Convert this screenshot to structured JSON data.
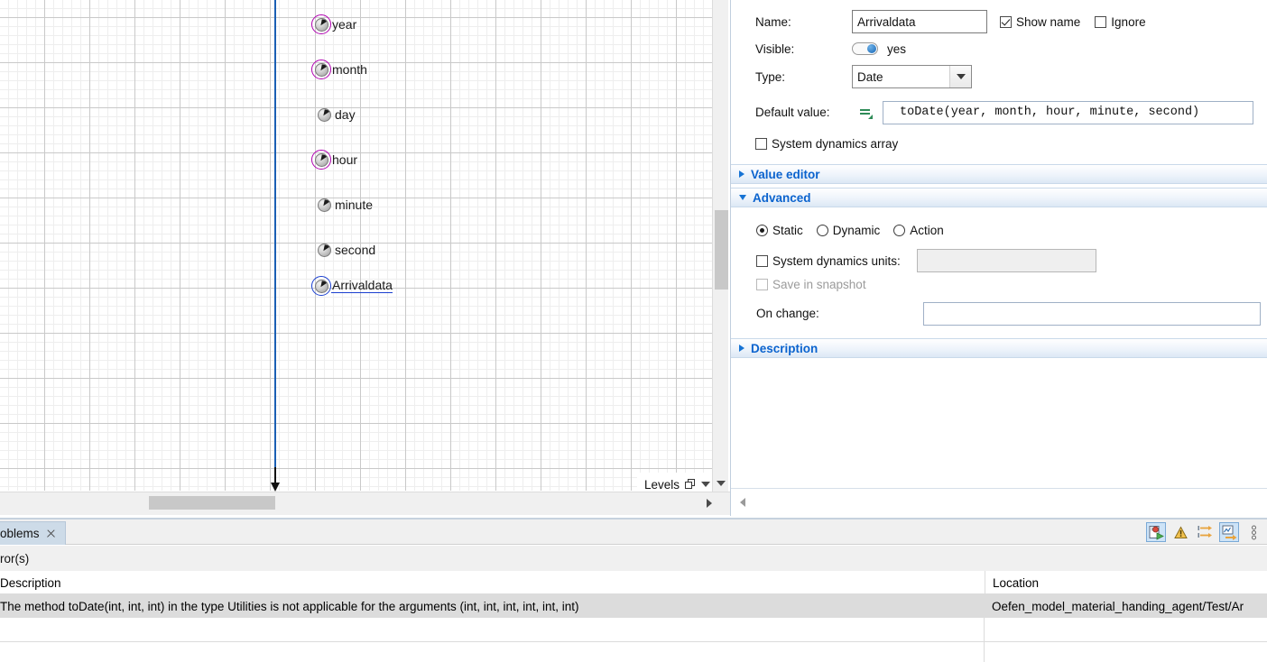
{
  "canvas": {
    "parameters": [
      {
        "label": "year",
        "selected": true,
        "ring": "magenta",
        "underline": false
      },
      {
        "label": "month",
        "selected": true,
        "ring": "magenta",
        "underline": false
      },
      {
        "label": "day",
        "selected": false,
        "ring": "none",
        "underline": false
      },
      {
        "label": "hour",
        "selected": true,
        "ring": "magenta",
        "underline": false
      },
      {
        "label": "minute",
        "selected": false,
        "ring": "none",
        "underline": false
      },
      {
        "label": "second",
        "selected": false,
        "ring": "none",
        "underline": false
      },
      {
        "label": "Arrivaldata",
        "selected": true,
        "ring": "blue",
        "underline": true
      }
    ],
    "levels_label": "Levels"
  },
  "properties": {
    "name": {
      "label": "Name:",
      "value": "Arrivaldata",
      "show_name_label": "Show name",
      "show_name_checked": true,
      "ignore_label": "Ignore",
      "ignore_checked": false
    },
    "visible": {
      "label": "Visible:",
      "value": "yes",
      "on": true
    },
    "type": {
      "label": "Type:",
      "value": "Date"
    },
    "default_value": {
      "label": "Default value:",
      "value": "toDate(year, month, hour, minute, second)"
    },
    "system_dynamics_array": {
      "label": "System dynamics array",
      "checked": false
    },
    "sections": {
      "value_editor": {
        "title": "Value editor",
        "expanded": false
      },
      "advanced": {
        "title": "Advanced",
        "expanded": true
      },
      "description": {
        "title": "Description",
        "expanded": false
      }
    },
    "advanced": {
      "mode_options": [
        "Static",
        "Dynamic",
        "Action"
      ],
      "mode_selected": "Static",
      "system_dynamics_units": {
        "label": "System dynamics units:",
        "checked": false,
        "value": ""
      },
      "save_in_snapshot": {
        "label": "Save in snapshot",
        "checked": false,
        "disabled": true
      },
      "on_change": {
        "label": "On change:",
        "value": ""
      }
    }
  },
  "problems": {
    "tab_label": "oblems",
    "count_label": "ror(s)",
    "columns": {
      "description": "Description",
      "location": "Location"
    },
    "rows": [
      {
        "description": "The method toDate(int, int, int) in the type Utilities is not applicable for the arguments (int, int, int, int, int, int)",
        "location": "Oefen_model_material_handing_agent/Test/Ar"
      }
    ],
    "toolbar_icons": [
      "problems-filter-icon",
      "warning-icon",
      "group-by-icon",
      "focus-icon",
      "view-menu-icon"
    ]
  },
  "colors": {
    "accent_blue": "#0b63ce",
    "selection_magenta": "#b000b0",
    "selection_blue": "#1a3fd0",
    "axis_blue": "#1a5fb4",
    "row_highlight": "#dcdcdc",
    "tab_active": "#cddbe8"
  }
}
